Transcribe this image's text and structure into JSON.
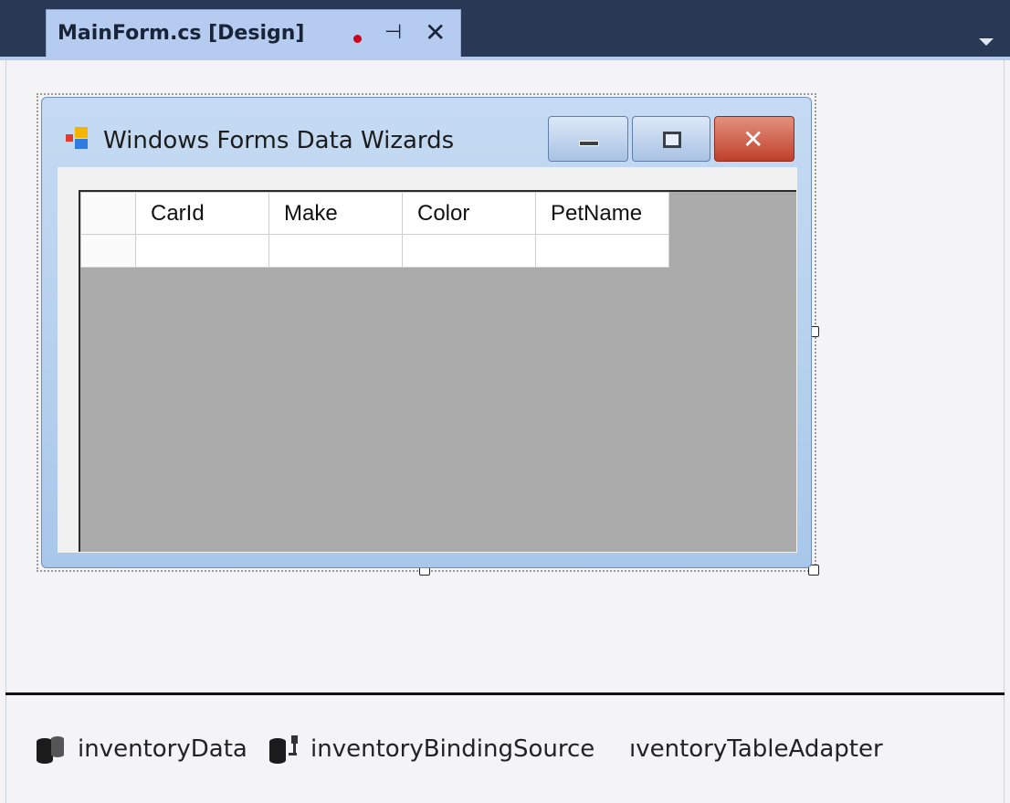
{
  "tab": {
    "title": "MainForm.cs [Design]",
    "pin_glyph": "⊣",
    "close_glyph": "✕"
  },
  "form": {
    "title": "Windows Forms Data Wizards",
    "icon": "windows-forms-app-icon",
    "close_glyph": "✕"
  },
  "grid": {
    "columns": [
      "CarId",
      "Make",
      "Color",
      "PetName"
    ],
    "rows": [
      [
        "",
        "",
        "",
        ""
      ]
    ]
  },
  "tray": {
    "components": [
      {
        "label": "inventoryData",
        "icon": "dataset-icon"
      },
      {
        "label": "inventoryBindingSource",
        "icon": "binding-source-icon"
      },
      {
        "label": "ıventoryTableAdapter",
        "icon": "table-adapter-icon"
      }
    ]
  },
  "colors": {
    "tab_strip": "#293955",
    "active_tab": "#b5cbef",
    "form_frame": "#a9c7ea",
    "grid_background": "#ababab",
    "close_button": "#c0402a"
  }
}
